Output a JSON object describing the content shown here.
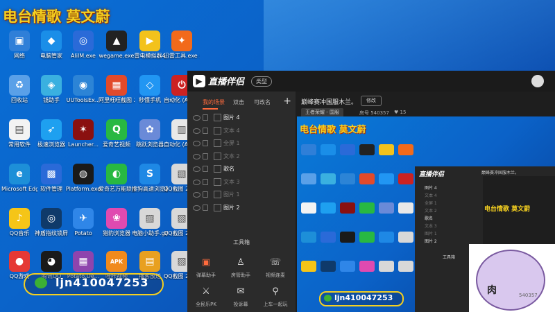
{
  "overlay": {
    "title": "电台情歌  莫文蔚",
    "qq_number": "ljn410047253"
  },
  "desktop_icons": [
    {
      "label": "网络",
      "color": "#2f7fd8",
      "glyph": "▣",
      "icon": "network-icon"
    },
    {
      "label": "电脑管家",
      "color": "#1a8ee8",
      "glyph": "◆",
      "icon": "shield-icon"
    },
    {
      "label": "AliIM.exe",
      "color": "#2a6ad8",
      "glyph": "◎",
      "icon": "aliim-icon"
    },
    {
      "label": "wegame.exe",
      "color": "#222222",
      "glyph": "▲",
      "icon": "wegame-icon"
    },
    {
      "label": "雷电模拟器4",
      "color": "#f3c21c",
      "glyph": "▶",
      "icon": "emulator-icon"
    },
    {
      "label": "迅雷工具.exe 点击这里",
      "color": "#f26a1b",
      "glyph": "✦",
      "icon": "tool-icon"
    },
    {
      "label": "回收站",
      "color": "#5aa0e8",
      "glyph": "♻",
      "icon": "recycle-bin-icon"
    },
    {
      "label": "钱助手",
      "color": "#3ab0e0",
      "glyph": "◈",
      "icon": "assistant-icon"
    },
    {
      "label": "UUToolsEx...",
      "color": "#2c84d6",
      "glyph": "◉",
      "icon": "uutools-icon"
    },
    {
      "label": "阿里旺旺截图 20210316...",
      "color": "#e24a2a",
      "glyph": "▦",
      "icon": "screenshot-icon"
    },
    {
      "label": "秒懂手机",
      "color": "#2196f3",
      "glyph": "◇",
      "icon": "phone-icon"
    },
    {
      "label": "自动化 (AutoGui...",
      "color": "#cc2222",
      "glyph": "⏻",
      "icon": "power-icon"
    },
    {
      "label": "常用软件",
      "color": "#f3f3f3",
      "glyph": "▤",
      "icon": "folder-icon"
    },
    {
      "label": "极速浏览器",
      "color": "#1ea0f0",
      "glyph": "➶",
      "icon": "browser-icon"
    },
    {
      "label": "Launcher...",
      "color": "#8a1010",
      "glyph": "✶",
      "icon": "launcher-icon"
    },
    {
      "label": "爱奇艺视频",
      "color": "#28b842",
      "glyph": "Q",
      "icon": "iqiyi-icon"
    },
    {
      "label": "跳跃浏览器",
      "color": "#6a8ad8",
      "glyph": "✿",
      "icon": "jump-browser-icon"
    },
    {
      "label": "自动化 (AutoGui...",
      "color": "#e8e8e8",
      "glyph": "▥",
      "icon": "autogui-icon"
    },
    {
      "label": "Microsoft Edge",
      "color": "#1d8fd8",
      "glyph": "e",
      "icon": "edge-icon"
    },
    {
      "label": "软件管理",
      "color": "#2a6ad8",
      "glyph": "▩",
      "icon": "software-icon"
    },
    {
      "label": "Platform.exe",
      "color": "#1a1a1a",
      "glyph": "◍",
      "icon": "platform-icon"
    },
    {
      "label": "爱奇艺万能联播",
      "color": "#28b842",
      "glyph": "◐",
      "icon": "iqiyi-cast-icon"
    },
    {
      "label": "搜狗高速浏览器",
      "color": "#1e88e5",
      "glyph": "S",
      "icon": "sogou-icon"
    },
    {
      "label": "QQ截图 202103...",
      "color": "#d8d8d8",
      "glyph": "▧",
      "icon": "qq-screenshot-icon"
    },
    {
      "label": "QQ音乐",
      "color": "#f5c518",
      "glyph": "♪",
      "icon": "qqmusic-icon"
    },
    {
      "label": "神盾指纹锁屏",
      "color": "#0f3a6a",
      "glyph": "◎",
      "icon": "fingerprint-icon"
    },
    {
      "label": "Potato",
      "color": "#2f86e8",
      "glyph": "✈",
      "icon": "potato-icon"
    },
    {
      "label": "猎豹浏览器",
      "color": "#e04ab0",
      "glyph": "❀",
      "icon": "cheetah-icon"
    },
    {
      "label": "电脑小助手.gif",
      "color": "#d8d8d8",
      "glyph": "▨",
      "icon": "gif-icon"
    },
    {
      "label": "QQ截图 2021...",
      "color": "#d8d8d8",
      "glyph": "▧",
      "icon": "qq-screenshot-icon"
    },
    {
      "label": "QQ游戏",
      "color": "#e53935",
      "glyph": "●",
      "icon": "qqgame-icon"
    },
    {
      "label": "腾讯QQ",
      "color": "#1a1a1a",
      "glyph": "◕",
      "icon": "qq-icon"
    },
    {
      "label": "Potato.De...",
      "color": "#8e44ad",
      "glyph": "▦",
      "icon": "rar-icon"
    },
    {
      "label": "哇咔视频",
      "color": "#f08a1c",
      "glyph": "APK",
      "icon": "apk-icon"
    },
    {
      "label": "播客放送",
      "color": "#e8a020",
      "glyph": "▤",
      "icon": "folder-icon"
    },
    {
      "label": "QQ截图 2021...",
      "color": "#d8d8d8",
      "glyph": "▧",
      "icon": "qq-screenshot-icon"
    }
  ],
  "app": {
    "logo_text": "直播伴侣",
    "type_button": "类型",
    "tabs": [
      {
        "label": "我的场景",
        "active": true
      },
      {
        "label": "双击",
        "active": false
      },
      {
        "label": "可改名",
        "active": false
      }
    ],
    "add_label": "+",
    "sources": [
      {
        "name": "图片 4",
        "on": true
      },
      {
        "name": "文本 4",
        "on": false
      },
      {
        "name": "全屏 1",
        "on": false
      },
      {
        "name": "文本 2",
        "on": false
      },
      {
        "name": "歌名",
        "on": true
      },
      {
        "name": "文本 3",
        "on": false
      },
      {
        "name": "图片 1",
        "on": false
      },
      {
        "name": "图片 2",
        "on": true
      }
    ],
    "toolbox_title": "工具箱",
    "tools": [
      {
        "label": "弹幕助手",
        "glyph": "▣",
        "active": true
      },
      {
        "label": "房管助手",
        "glyph": "♙",
        "active": false
      },
      {
        "label": "视频连麦",
        "glyph": "☏",
        "active": false
      },
      {
        "label": "全民乐PK",
        "glyph": "⚔",
        "active": false
      },
      {
        "label": "投诉幕",
        "glyph": "✉",
        "active": false
      },
      {
        "label": "上车一起玩",
        "glyph": "⚲",
        "active": false
      }
    ],
    "room": {
      "title": "巅峰赛冲国服木兰。",
      "edit_button": "修改",
      "category": "王者荣耀 - 国服",
      "room_id": "房号 540357",
      "likes": "15"
    }
  },
  "preview": {
    "title": "电台情歌  莫文蔚",
    "sub_title": "电台情歌  莫文蔚",
    "qq_number": "ljn410047253",
    "sub_logo": "直播伴侣",
    "sub_room": "巅峰赛冲国服木兰。",
    "sub_sources": [
      "图片 4",
      "文本 4",
      "全屏 1",
      "文本 2",
      "歌名",
      "文本 3",
      "图片 1",
      "图片 2"
    ],
    "sub_toolbox": "工具箱"
  },
  "meme": {
    "text": "肉",
    "overlay_id": "540357"
  }
}
